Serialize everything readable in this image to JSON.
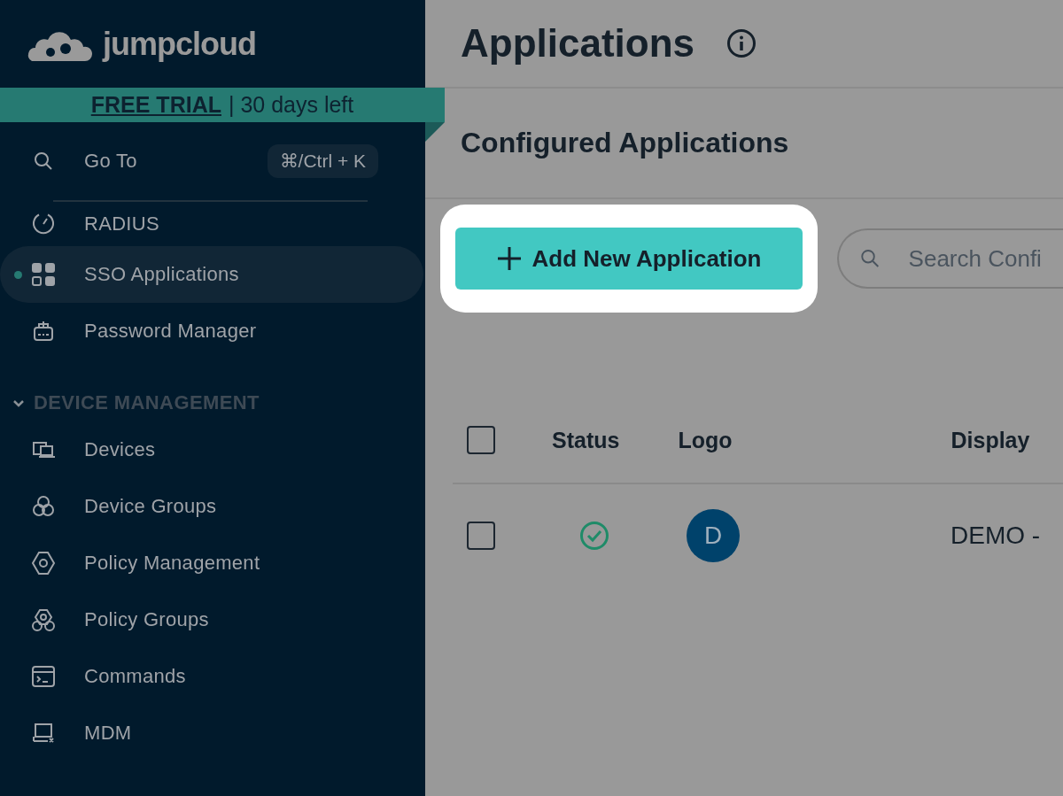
{
  "logo": {
    "text": "jumpcloud"
  },
  "trial_banner": {
    "label": "FREE TRIAL",
    "text": "| 30 days left"
  },
  "goto": {
    "label": "Go To",
    "shortcut": "⌘/Ctrl + K"
  },
  "nav_items": [
    {
      "label": "RADIUS",
      "selected": false
    },
    {
      "label": "SSO Applications",
      "selected": true
    },
    {
      "label": "Password Manager",
      "selected": false
    }
  ],
  "section": {
    "title": "DEVICE MANAGEMENT",
    "expanded": true,
    "items": [
      {
        "label": "Devices",
        "selected": false
      },
      {
        "label": "Device Groups",
        "selected": false
      },
      {
        "label": "Policy Management",
        "selected": false
      },
      {
        "label": "Policy Groups",
        "selected": false
      },
      {
        "label": "Commands",
        "selected": false
      },
      {
        "label": "MDM",
        "selected": false
      }
    ]
  },
  "page": {
    "title": "Applications",
    "subtitle": "Configured Applications"
  },
  "add_button": {
    "label": "Add New Application",
    "highlighted": true
  },
  "search": {
    "placeholder": "Search Confi"
  },
  "table": {
    "select_all_checked": false,
    "columns": [
      "Status",
      "Logo",
      "Display"
    ],
    "rows": [
      {
        "checked": false,
        "active": true,
        "logo_initial": "D",
        "display_name": "DEMO -"
      }
    ]
  }
}
